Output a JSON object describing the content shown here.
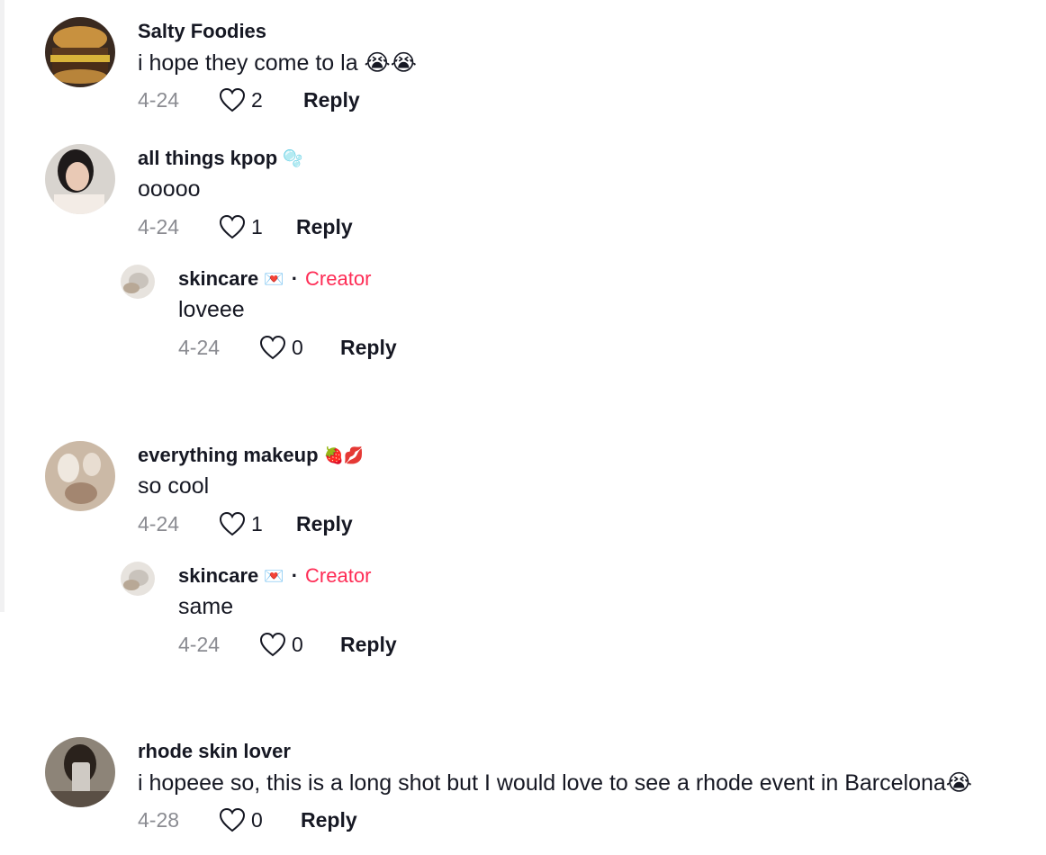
{
  "comments": [
    {
      "username": "Salty Foodies",
      "text": "i hope they come to la 😭😭",
      "date": "4-24",
      "likes": "2",
      "reply_label": "Reply"
    },
    {
      "username": "all things kpop",
      "badge": "🫧",
      "text": "ooooo",
      "date": "4-24",
      "likes": "1",
      "reply_label": "Reply"
    },
    {
      "username": "skincare",
      "badge": "💌",
      "creator_label": "Creator",
      "text": "loveee",
      "date": "4-24",
      "likes": "0",
      "reply_label": "Reply"
    },
    {
      "username": "everything makeup",
      "badge": "🍓💋",
      "text": "so cool",
      "date": "4-24",
      "likes": "1",
      "reply_label": "Reply"
    },
    {
      "username": "skincare",
      "badge": "💌",
      "creator_label": "Creator",
      "text": "same",
      "date": "4-24",
      "likes": "0",
      "reply_label": "Reply"
    },
    {
      "username": "rhode skin lover",
      "text": "i hopeee so, this is a long shot but I would love to see a rhode event in Barcelona😭",
      "date": "4-28",
      "likes": "0",
      "reply_label": "Reply"
    }
  ],
  "icons": {
    "like": "heart-outline-icon"
  },
  "colors": {
    "creator": "#fe2c55",
    "muted": "#8a8b91",
    "text": "#161823"
  }
}
